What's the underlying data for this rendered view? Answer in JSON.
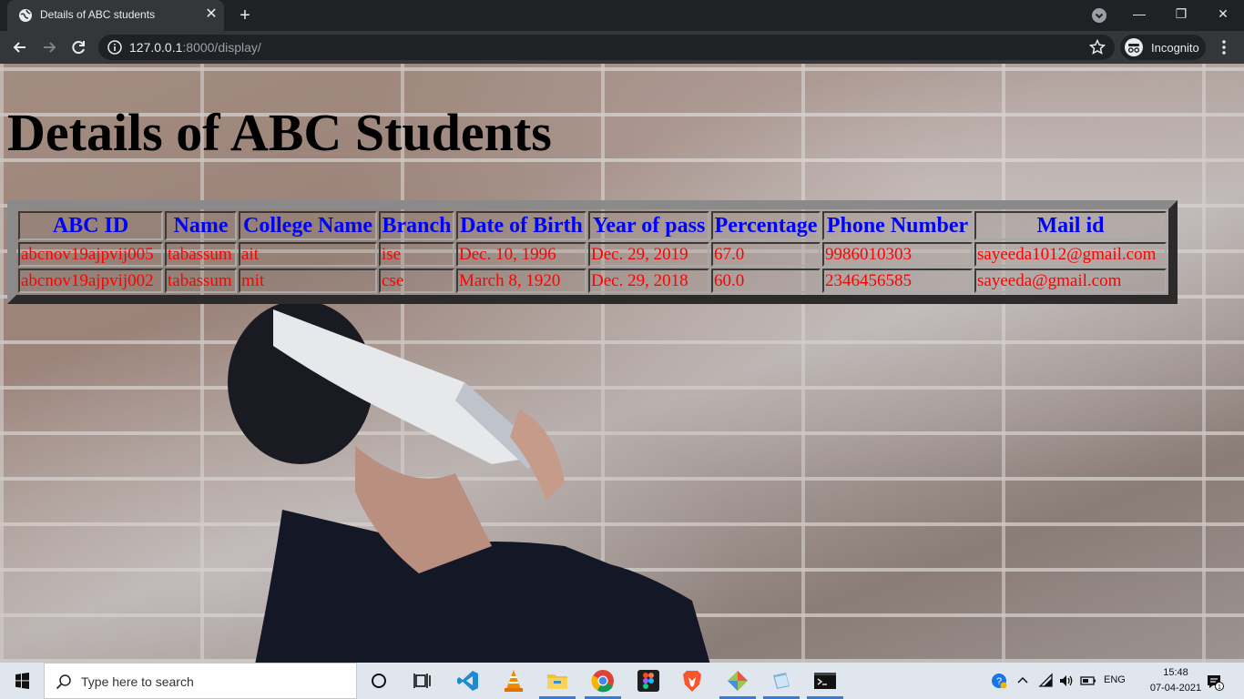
{
  "browser": {
    "tab_title": "Details of ABC students",
    "url_host": "127.0.0.1",
    "url_rest": ":8000/display/",
    "incognito_label": "Incognito"
  },
  "page": {
    "heading": "Details of ABC Students",
    "table": {
      "headers": [
        "ABC ID",
        "Name",
        "College Name",
        "Branch",
        "Date of Birth",
        "Year of pass",
        "Percentage",
        "Phone Number",
        "Mail id"
      ],
      "rows": [
        [
          "abcnov19ajpvij005",
          "tabassum",
          "ait",
          "ise",
          "Dec. 10, 1996",
          "Dec. 29, 2019",
          "67.0",
          "9986010303",
          "sayeeda1012@gmail.com"
        ],
        [
          "abcnov19ajpvij002",
          "tabassum",
          "mit",
          "cse",
          "March 8, 1920",
          "Dec. 29, 2018",
          "60.0",
          "2346456585",
          "sayeeda@gmail.com"
        ]
      ]
    }
  },
  "taskbar": {
    "search_placeholder": "Type here to search",
    "language": "ENG",
    "time": "15:48",
    "date": "07-04-2021",
    "notification_count": "1"
  },
  "colors": {
    "header_text": "#0000ff",
    "cell_text": "#ff0000",
    "heading_text": "#000000"
  }
}
